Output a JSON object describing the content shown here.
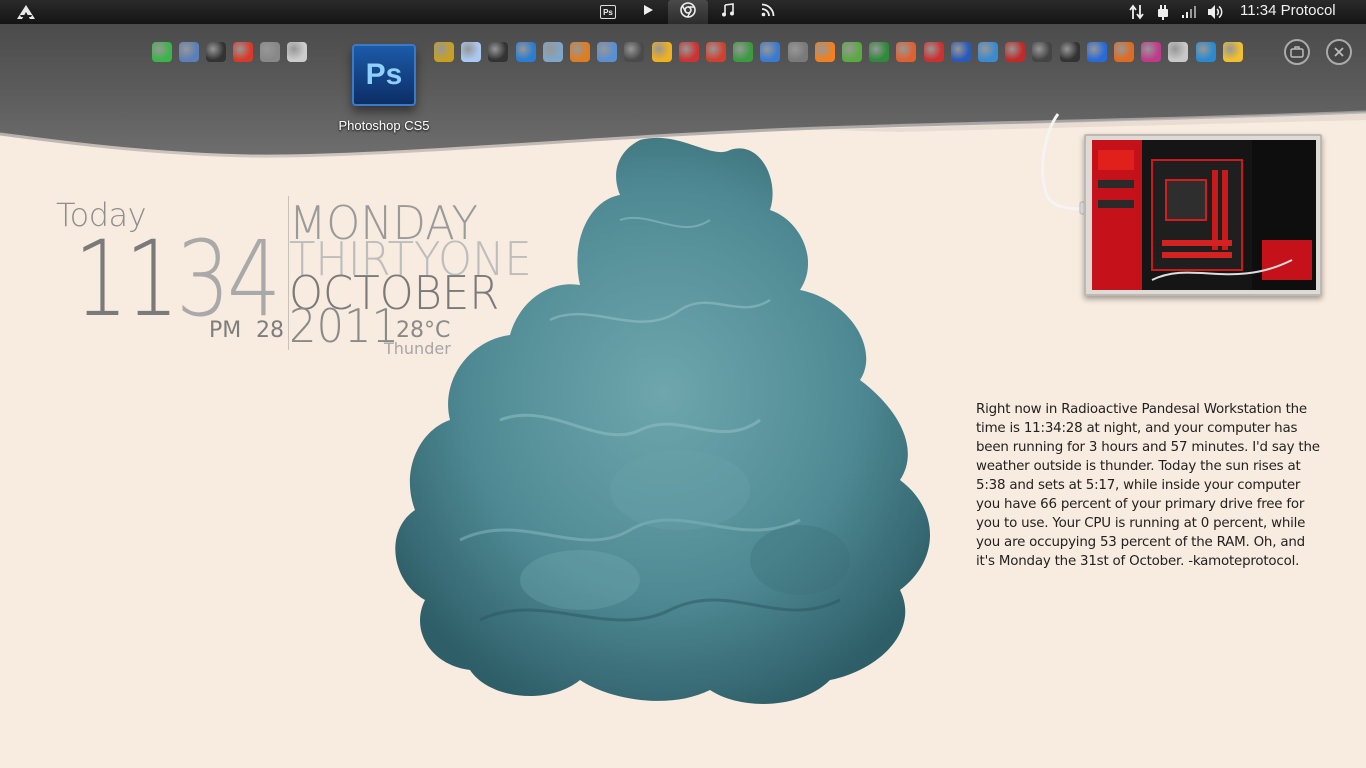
{
  "topbar": {
    "clock_text": "11:34 Protocol",
    "center_tabs": [
      {
        "icon": "photoshop-icon",
        "label": "Ps"
      },
      {
        "icon": "play-icon"
      },
      {
        "icon": "chrome-icon"
      },
      {
        "icon": "music-note-icon"
      },
      {
        "icon": "rss-icon"
      }
    ],
    "tray_icons": [
      "network-arrows-icon",
      "power-plug-icon",
      "signal-bars-icon",
      "volume-icon"
    ]
  },
  "dock": {
    "launcher": {
      "icon": "photoshop-icon",
      "badge": "Ps",
      "label": "Photoshop CS5"
    },
    "icon_colors": [
      "#3bb54a",
      "#5b7fb7",
      "#333333",
      "#d83a2a",
      "#888888",
      "#cccccc",
      "#c8a020",
      "#aac8f0",
      "#333333",
      "#2a7dd0",
      "#7fa6c8",
      "#e07c20",
      "#5a8fd0",
      "#4a4a4a",
      "#f0b020",
      "#cc3333",
      "#d04030",
      "#3c9a40",
      "#3a7ad0",
      "#7a7a7a",
      "#f08020",
      "#5aaa40",
      "#2f8a3a",
      "#e06030",
      "#cc3030",
      "#2a5ab8",
      "#3a8ad0",
      "#c02a2a",
      "#444444",
      "#333333",
      "#2a6ad8",
      "#e06a20",
      "#c03a8a",
      "#c8c8c8",
      "#2a8ad0",
      "#f0c030"
    ],
    "right_buttons": [
      {
        "name": "briefcase-button",
        "icon": "briefcase-icon"
      },
      {
        "name": "close-button",
        "icon": "close-icon"
      }
    ]
  },
  "clock_widget": {
    "label_today": "Today",
    "hour": "11",
    "minute": "34",
    "ampm": "PM",
    "seconds": "28",
    "weekday": "MONDAY",
    "day_words": "THIRTYONE",
    "month": "OCTOBER",
    "year": "2011",
    "temperature": "28°C",
    "condition": "Thunder"
  },
  "narrative": "Right now in Radioactive Pandesal Workstation the time is 11:34:28 at night, and your computer has been running for 3 hours and 57 minutes. I'd say the weather outside is thunder. Today the sun rises at 5:38 and sets at 5:17, while inside your computer you have 66 percent of your primary drive free for you to use. Your CPU is running at 0 percent, while you are occupying 53 percent of the RAM. Oh, and it's Monday the 31st of October. -kamoteprotocol.",
  "colors": {
    "background": "#f8ebdf",
    "ink": "#4f8a94",
    "topbar": "#1e1e1e"
  }
}
